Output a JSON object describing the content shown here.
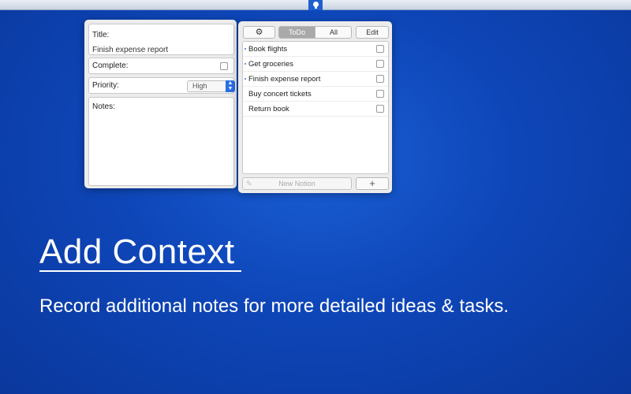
{
  "menubar": {
    "app_icon": "lightbulb-icon"
  },
  "detail": {
    "title_label": "Title:",
    "title_value": "Finish expense report",
    "complete_label": "Complete:",
    "priority_label": "Priority:",
    "priority_value": "High",
    "notes_label": "Notes:"
  },
  "list": {
    "gear_icon": "⚙",
    "segments": {
      "todo": "ToDo",
      "all": "All"
    },
    "edit_label": "Edit",
    "items": [
      {
        "label": "Book flights"
      },
      {
        "label": "Get groceries"
      },
      {
        "label": "Finish expense report"
      },
      {
        "label": "Buy concert tickets"
      },
      {
        "label": "Return book"
      }
    ],
    "new_placeholder": "New Notion",
    "add_label": "+"
  },
  "hero": {
    "headline": "Add Context",
    "subline": "Record additional notes for more detailed ideas & tasks."
  },
  "colors": {
    "accent": "#2a6ee6",
    "background": "#0e46b8"
  }
}
